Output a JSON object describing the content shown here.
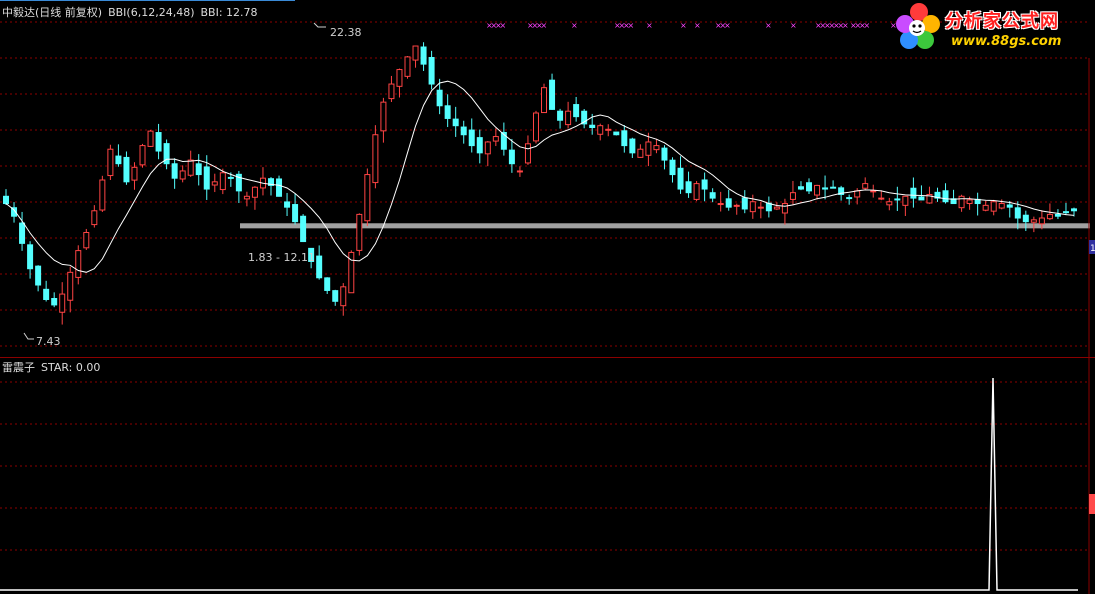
{
  "header": {
    "stock_name": "中毅达(日线 前复权)",
    "indicator_label": "BBI(6,12,24,48)",
    "indicator_value": "BBI: 12.78"
  },
  "annotations": {
    "high_label": "22.38",
    "low_label": "7.43",
    "range_label": "1.83 - 12.11"
  },
  "sub_header": {
    "indicator_name": "雷震子",
    "star_value": "STAR: 0.00"
  },
  "logo": {
    "title": "分析家公式网",
    "url": "www.88gs.com"
  },
  "right_edge_marker": "1",
  "colors": {
    "up_candle": "#ff4444",
    "down_candle": "#54ffff",
    "bbi_line": "#ffffff",
    "grid": "#8b0000",
    "signal_marks": "#ff44ff",
    "support_band": "#a0a0a0"
  },
  "chart_data": {
    "type": "candlestick",
    "title": "中毅达(日线 前复权)",
    "price_range": [
      5.0,
      24.0
    ],
    "support_band": [
      11.83,
      12.11
    ],
    "high_point": 22.38,
    "low_point": 7.43,
    "series": [
      {
        "name": "BBI",
        "last_value": 12.78
      },
      {
        "name": "STAR",
        "last_value": 0.0
      }
    ],
    "close_path": [
      13.2,
      12.5,
      11.0,
      9.6,
      8.7,
      7.9,
      7.6,
      8.2,
      9.4,
      10.6,
      11.6,
      12.8,
      14.5,
      16.2,
      15.4,
      14.4,
      15.2,
      16.4,
      17.2,
      16.1,
      15.4,
      14.6,
      15.0,
      15.6,
      14.8,
      14.0,
      14.4,
      14.9,
      14.6,
      13.9,
      13.6,
      14.1,
      14.6,
      14.2,
      13.6,
      13.0,
      12.2,
      11.1,
      10.0,
      9.1,
      8.4,
      7.8,
      8.6,
      10.5,
      12.6,
      14.8,
      17.0,
      18.8,
      19.8,
      20.6,
      21.3,
      21.9,
      20.9,
      19.8,
      18.6,
      17.9,
      17.5,
      17.0,
      16.4,
      16.0,
      16.6,
      16.9,
      16.2,
      15.4,
      15.0,
      16.5,
      18.2,
      19.6,
      18.4,
      17.8,
      18.3,
      18.0,
      17.6,
      17.4,
      17.5,
      17.3,
      17.0,
      16.4,
      16.0,
      16.2,
      16.6,
      16.4,
      15.6,
      14.8,
      14.0,
      13.8,
      14.3,
      14.0,
      13.5,
      13.2,
      13.0,
      13.1,
      12.9,
      13.3,
      13.0,
      12.8,
      13.0,
      13.2,
      13.8,
      14.0,
      13.9,
      14.2,
      14.0,
      14.1,
      13.7,
      13.5,
      13.9,
      14.3,
      13.9,
      13.5,
      13.3,
      13.4,
      13.6,
      13.5,
      13.4,
      13.7,
      13.5,
      13.3,
      13.2,
      13.6,
      13.4,
      13.2,
      13.1,
      13.3,
      13.2,
      13.0,
      12.4,
      12.2,
      12.3,
      12.4,
      12.6,
      12.5,
      12.7,
      12.8
    ],
    "star_signal": {
      "values": [
        0,
        100,
        0
      ],
      "spike_count": 1
    }
  }
}
